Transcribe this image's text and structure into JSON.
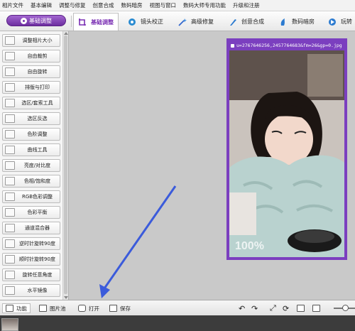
{
  "menu": [
    "相片文件",
    "基本编辑",
    "调整与修复",
    "创意合成",
    "数码暗房",
    "视图与窗口",
    "数码大师专用功能",
    "升级和注册"
  ],
  "toolbar": {
    "mode_button": "基础调整",
    "tabs": [
      "基础调整",
      "镜头校正",
      "高级修复",
      "创意合成",
      "数码暗房",
      "玩转"
    ]
  },
  "tools": [
    "调整相片大小",
    "自由裁剪",
    "自由旋转",
    "排版与打印",
    "选区/套索工具",
    "选区反选",
    "色阶调整",
    "曲线工具",
    "亮度/对比度",
    "色相/饱和度",
    "RGB色彩调整",
    "色彩平衡",
    "通道混合器",
    "逆时针旋转90度",
    "顺时针旋转90度",
    "旋转任意角度",
    "水平镜像"
  ],
  "image": {
    "filename": "u=2767646256,2457764683&fm=26&gp=0.jpg",
    "zoom": "100%"
  },
  "status": {
    "function_tab": "功能",
    "library_tab": "图片池",
    "open_label": "打开",
    "save_label": "保存"
  },
  "colors": {
    "accent": "#7b3fbf",
    "annotation_arrow": "#3b5bdb"
  }
}
